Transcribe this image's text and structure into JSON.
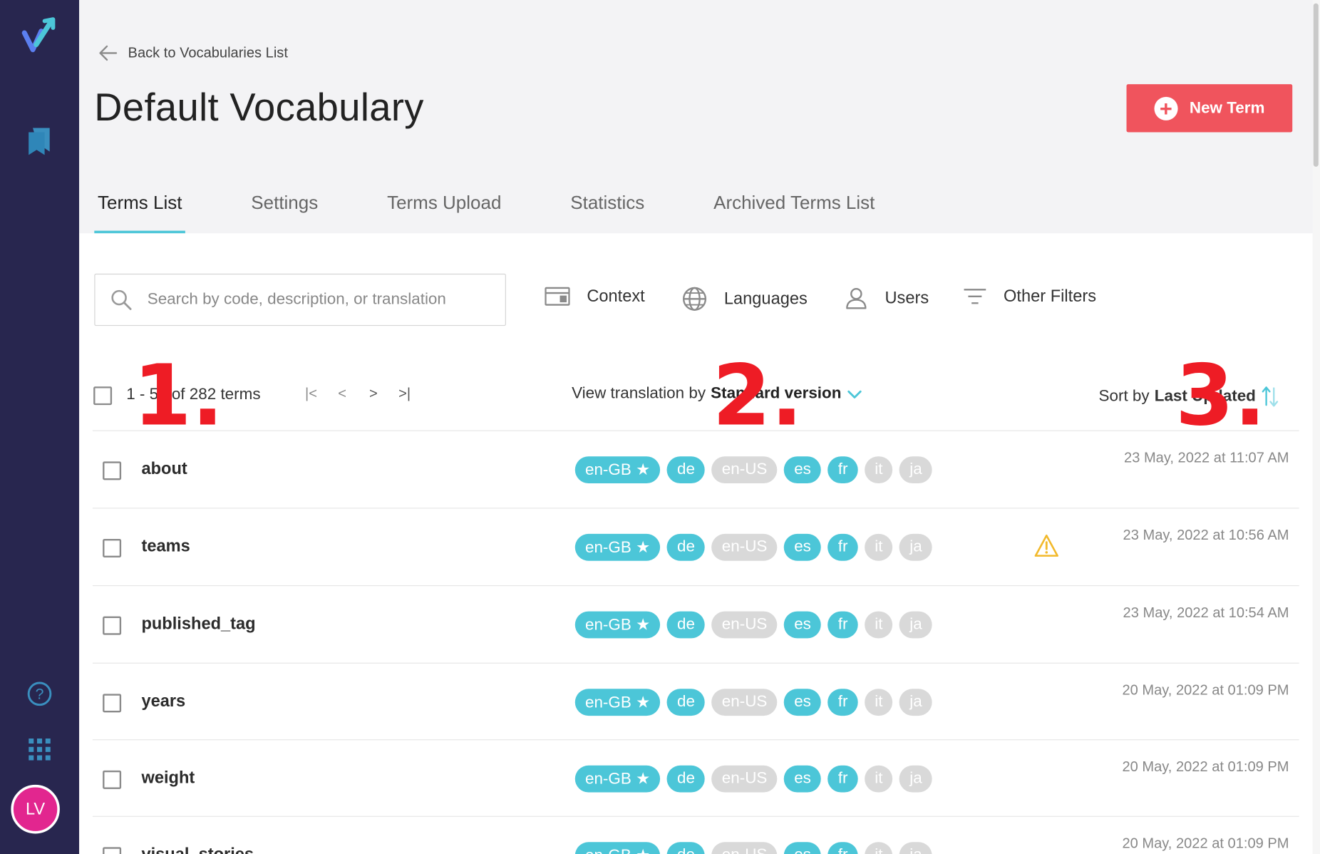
{
  "sidebar": {
    "icons": [
      "logo-icon",
      "vocabulary-book-icon",
      "help-icon",
      "apps-grid-icon"
    ],
    "avatar_initials": "LV",
    "avatar_color": "#e2268f",
    "background": "#28264f"
  },
  "header": {
    "back_label": "Back to Vocabularies List",
    "title": "Default Vocabulary",
    "new_term_label": "New Term",
    "accent": "#f0545d"
  },
  "tabs": [
    {
      "label": "Terms List",
      "active": true
    },
    {
      "label": "Settings",
      "active": false
    },
    {
      "label": "Terms Upload",
      "active": false
    },
    {
      "label": "Statistics",
      "active": false
    },
    {
      "label": "Archived Terms List",
      "active": false
    }
  ],
  "search": {
    "placeholder": "Search by code, description, or translation"
  },
  "filters": {
    "context": "Context",
    "languages": "Languages",
    "users": "Users",
    "other": "Other Filters"
  },
  "toolbar": {
    "count_text": "1 - 50 of 282 terms",
    "view_prefix": "View translation by",
    "view_value": "Standard version",
    "sort_prefix": "Sort by",
    "sort_value": "Last Updated"
  },
  "annotations": [
    "1.",
    "2.",
    "3."
  ],
  "languages": [
    {
      "code": "en-GB ★",
      "enabled": true
    },
    {
      "code": "de",
      "enabled": true
    },
    {
      "code": "en-US",
      "enabled": false
    },
    {
      "code": "es",
      "enabled": true
    },
    {
      "code": "fr",
      "enabled": true
    },
    {
      "code": "it",
      "enabled": false
    },
    {
      "code": "ja",
      "enabled": false
    }
  ],
  "rows": [
    {
      "code": "about",
      "date": "23 May, 2022 at 11:07 AM",
      "warning": false
    },
    {
      "code": "teams",
      "date": "23 May, 2022 at 10:56 AM",
      "warning": true
    },
    {
      "code": "published_tag",
      "date": "23 May, 2022 at 10:54 AM",
      "warning": false
    },
    {
      "code": "years",
      "date": "20 May, 2022 at 01:09 PM",
      "warning": false
    },
    {
      "code": "weight",
      "date": "20 May, 2022 at 01:09 PM",
      "warning": false
    },
    {
      "code": "visual_stories",
      "date": "20 May, 2022 at 01:09 PM",
      "warning": false
    }
  ],
  "colors": {
    "accent_teal": "#4cc6d8",
    "pill_off": "#d9d9d9",
    "warning": "#f2b92b",
    "annotation_red": "#ee1c25"
  }
}
